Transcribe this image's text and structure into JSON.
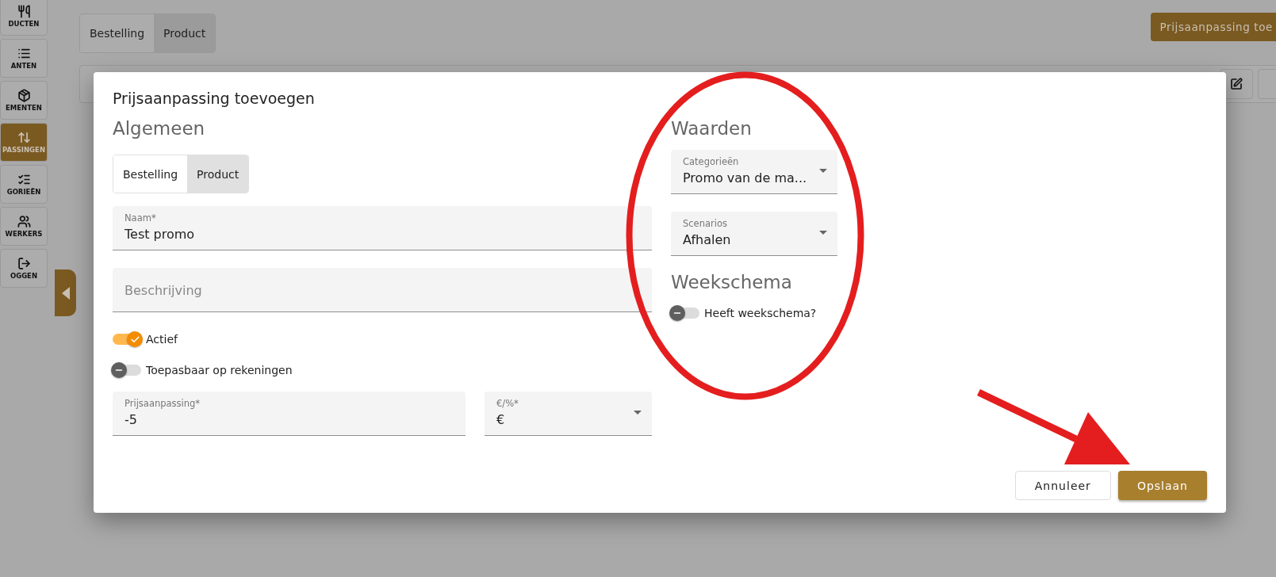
{
  "sidebar": {
    "items": [
      {
        "label": "DUCTEN",
        "selected": false
      },
      {
        "label": "ANTEN",
        "selected": false
      },
      {
        "label": "EMENTEN",
        "selected": false
      },
      {
        "label": "PASSINGEN",
        "selected": true
      },
      {
        "label": "GORIEËN",
        "selected": false
      },
      {
        "label": "WERKERS",
        "selected": false
      },
      {
        "label": "OGGEN",
        "selected": false
      }
    ]
  },
  "page": {
    "tabs": [
      {
        "label": "Bestelling",
        "selected": false
      },
      {
        "label": "Product",
        "selected": true
      }
    ],
    "add_button": "Prijsaanpassing toe"
  },
  "dialog": {
    "title": "Prijsaanpassing toevoegen",
    "general": {
      "heading": "Algemeen",
      "tabs": [
        {
          "label": "Bestelling",
          "selected": false
        },
        {
          "label": "Product",
          "selected": true
        }
      ],
      "name": {
        "label": "Naam*",
        "value": "Test promo"
      },
      "description": {
        "placeholder": "Beschrijving"
      },
      "toggles": [
        {
          "label": "Actief",
          "on": true
        },
        {
          "label": "Toepasbaar op rekeningen",
          "on": false
        }
      ],
      "adjustment": {
        "label": "Prijsaanpassing*",
        "value": "-5"
      },
      "unit": {
        "label": "€/%*",
        "value": "€"
      }
    },
    "values": {
      "heading": "Waarden",
      "selects": [
        {
          "label": "Categorieën",
          "value": "Promo van de ma..."
        },
        {
          "label": "Scenarios",
          "value": "Afhalen"
        }
      ]
    },
    "schedule": {
      "heading": "Weekschema",
      "toggle": {
        "label": "Heeft weekschema?",
        "on": false
      }
    },
    "buttons": [
      {
        "label": "Annuleer",
        "kind": "secondary"
      },
      {
        "label": "Opslaan",
        "kind": "primary"
      }
    ]
  },
  "annotations": {
    "highlight_ellipse": true,
    "pointer_arrow": true
  }
}
